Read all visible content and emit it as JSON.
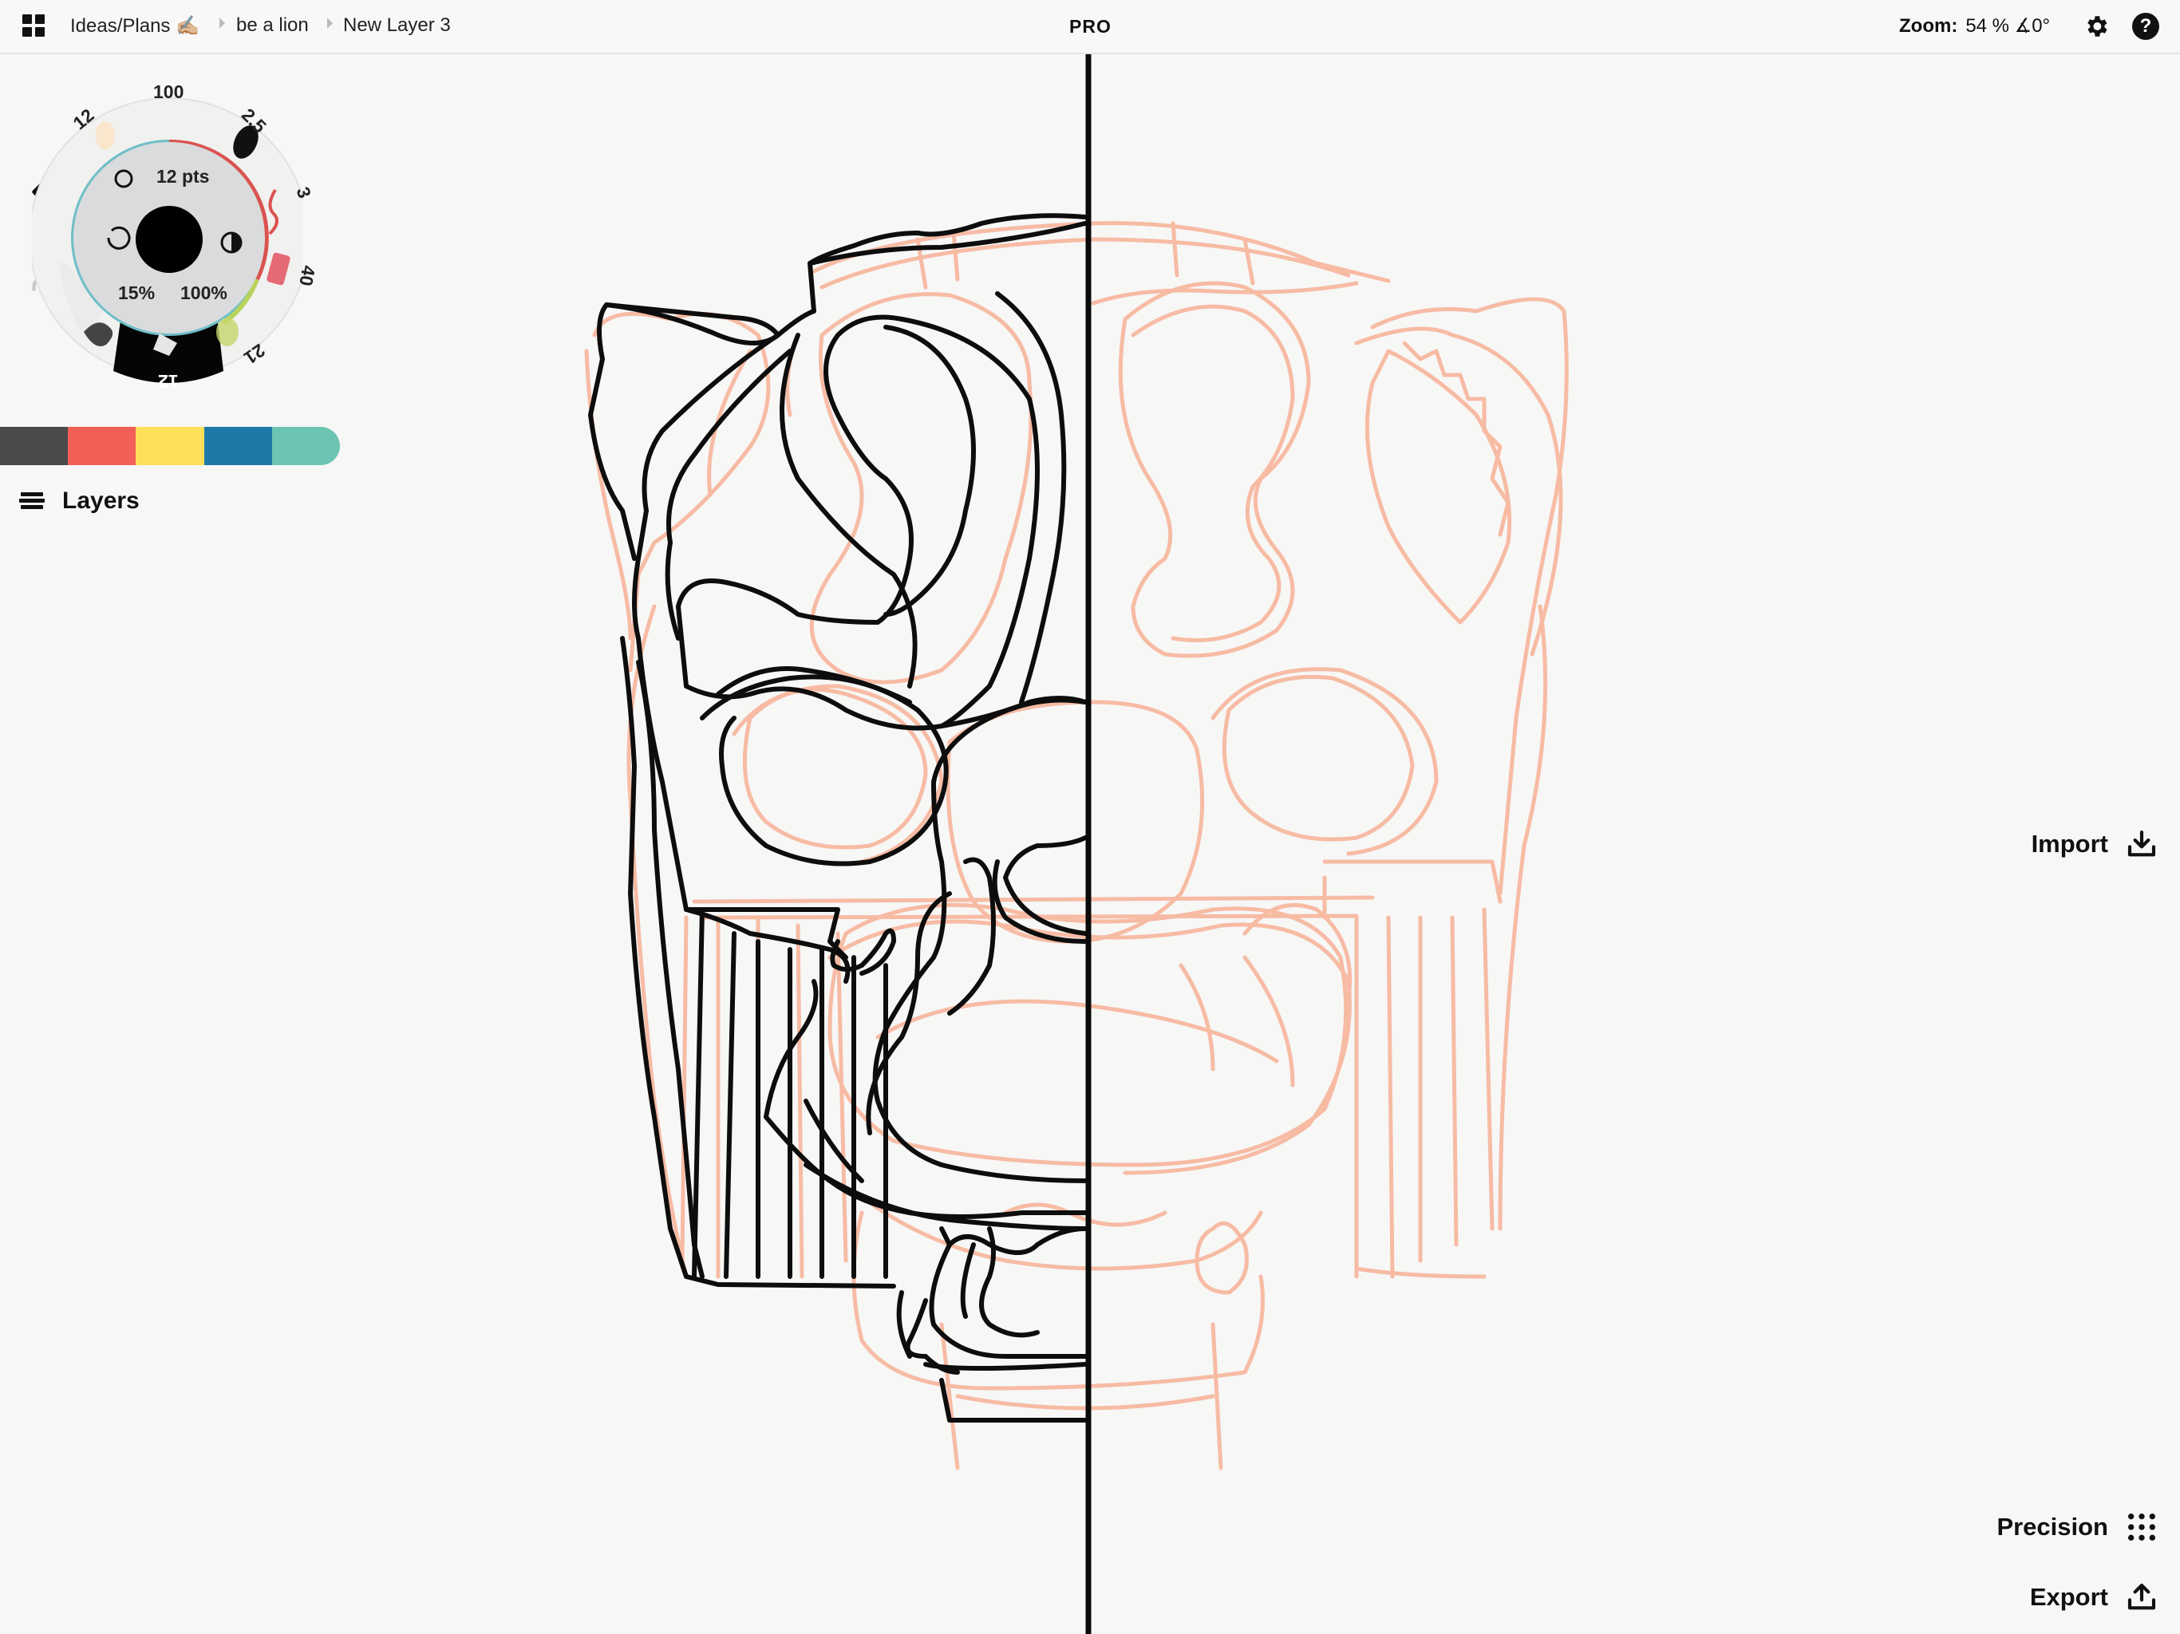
{
  "breadcrumb": {
    "root": "Ideas/Plans ✍🏼",
    "drawing": "be a lion",
    "layer": "New Layer 3"
  },
  "badge": "PRO",
  "zoom": {
    "label": "Zoom:",
    "value": "54 % ∡0°"
  },
  "help_label": "?",
  "tool_wheel": {
    "top_value": "100",
    "left_size": "12",
    "right_size_1": "2.5",
    "right_size_2": "3",
    "right_size_3": "40",
    "right_size_4": "21",
    "active_size": "12",
    "size_readout": "12 pts",
    "smoothing": "15%",
    "opacity": "100%",
    "brush_color": "#000000"
  },
  "palette": [
    "#4a4a4a",
    "#f25f57",
    "#fde05a",
    "#1f79a8",
    "#6ec4b2"
  ],
  "layers_label": "Layers",
  "actions": {
    "import": "Import",
    "precision": "Precision",
    "export": "Export"
  },
  "colors": {
    "sketch": "#f7b8a0",
    "ink": "#111111"
  }
}
